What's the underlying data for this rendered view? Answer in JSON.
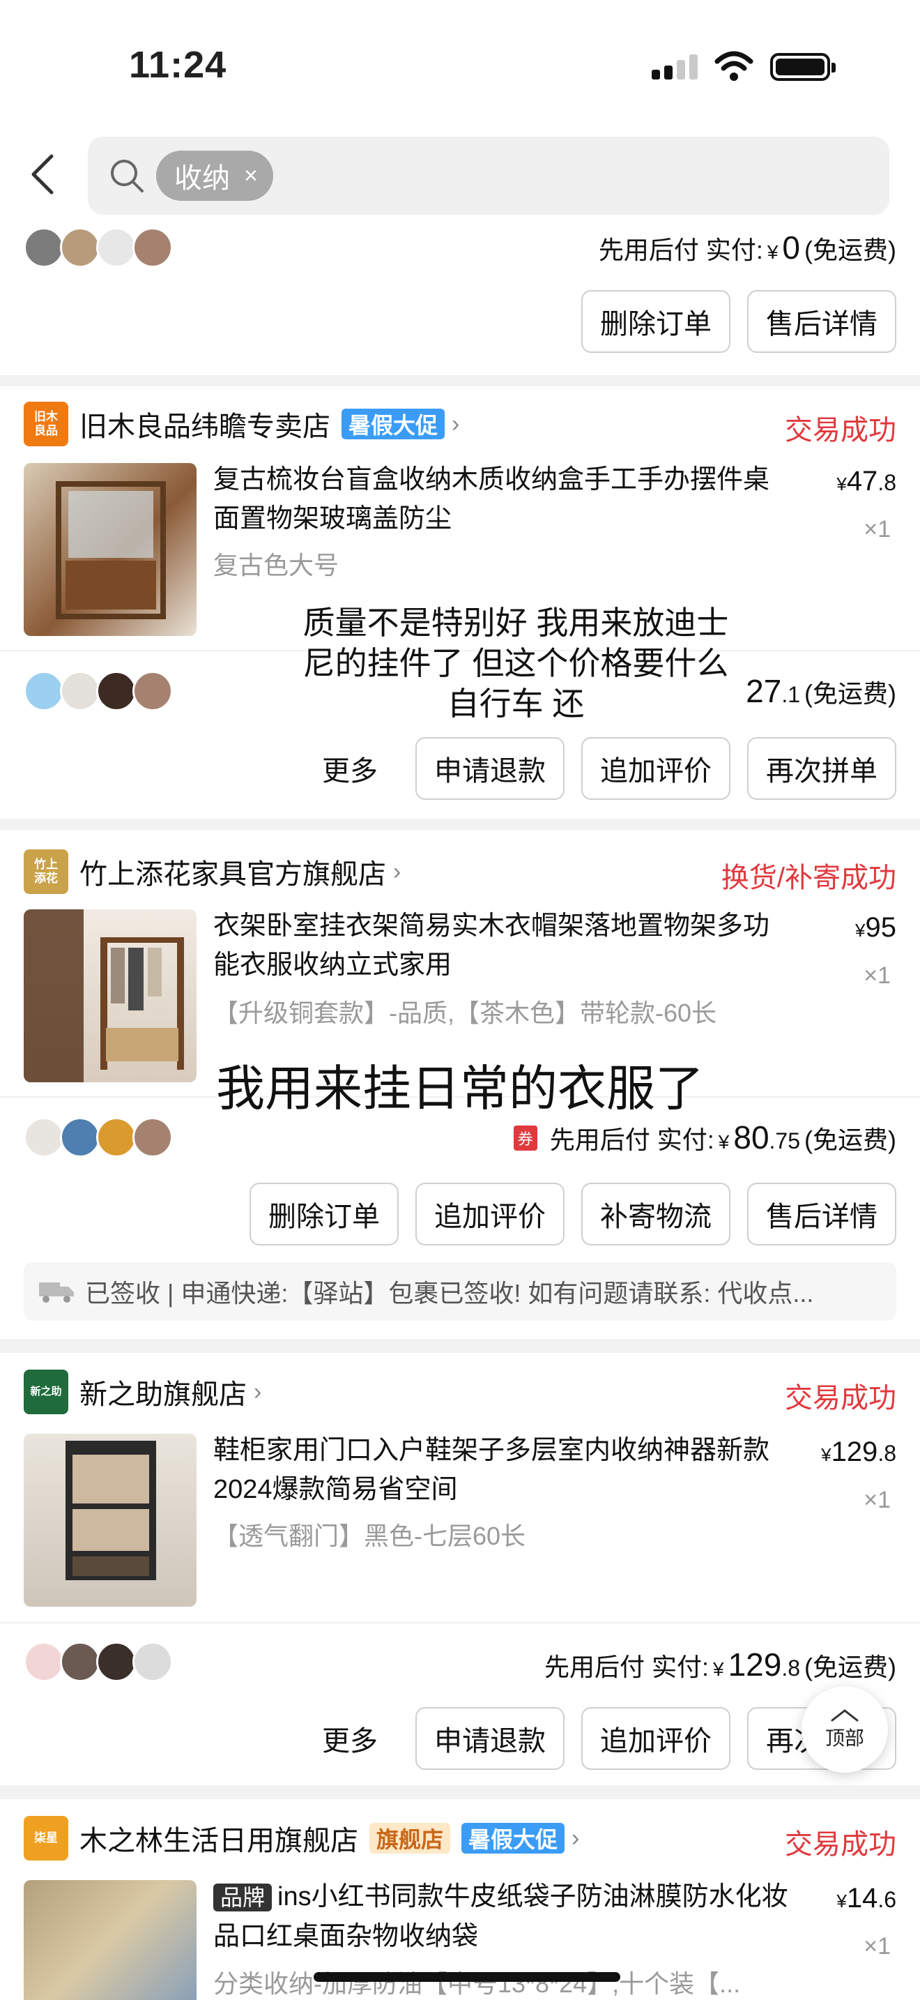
{
  "status_bar": {
    "time": "11:24"
  },
  "search": {
    "chip": "收纳",
    "chip_clear": "×"
  },
  "partial_order": {
    "payment_label": "先用后付 实付:",
    "currency": "¥",
    "amount": "0",
    "shipping": "(免运费)",
    "buttons": [
      "删除订单",
      "售后详情"
    ]
  },
  "orders": [
    {
      "shop_logo": "旧木\n良品",
      "shop_name": "旧木良品纬瞻专卖店",
      "tags": [
        "暑假大促"
      ],
      "status": "交易成功",
      "title": "复古梳妆台盲盒收纳木质收纳盒手工手办摆件桌面置物架玻璃盖防尘",
      "spec": "复古色大号",
      "price_int": "47",
      "price_dec": ".8",
      "qty": "×1",
      "amount_int": "27",
      "amount_dec": ".1",
      "shipping": "(免运费)",
      "more": "更多",
      "buttons": [
        "申请退款",
        "追加评价",
        "再次拼单"
      ]
    },
    {
      "shop_logo": "竹上\n添花",
      "shop_name": "竹上添花家具官方旗舰店",
      "status": "换货/补寄成功",
      "title": "衣架卧室挂衣架简易实木衣帽架落地置物架多功能衣服收纳立式家用",
      "spec": "【升级铜套款】-品质,【茶木色】带轮款-60长",
      "price_int": "95",
      "qty": "×1",
      "coupon": "券",
      "payment_label": "先用后付 实付:",
      "currency": "¥",
      "amount_int": "80",
      "amount_dec": ".75",
      "shipping": "(免运费)",
      "buttons": [
        "删除订单",
        "追加评价",
        "补寄物流",
        "售后详情"
      ],
      "logistics": "已签收 | 申通快递:【驿站】包裹已签收! 如有问题请联系: 代收点..."
    },
    {
      "shop_logo": "新之助",
      "shop_name": "新之助旗舰店",
      "status": "交易成功",
      "title": "鞋柜家用门口入户鞋架子多层室内收纳神器新款2024爆款简易省空间",
      "spec": "【透气翻门】黑色-七层60长",
      "price_int": "129",
      "price_dec": ".8",
      "qty": "×1",
      "payment_label": "先用后付 实付:",
      "currency": "¥",
      "amount_int": "129",
      "amount_dec": ".8",
      "shipping": "(免运费)",
      "more": "更多",
      "buttons": [
        "申请退款",
        "追加评价",
        "再次拼单"
      ]
    },
    {
      "shop_logo": "柒星",
      "shop_name": "木之林生活日用旗舰店",
      "tags": [
        "旗舰店",
        "暑假大促"
      ],
      "status": "交易成功",
      "brand_badge": "品牌",
      "title": "ins小红书同款牛皮纸袋子防油淋膜防水化妆品口红桌面杂物收纳袋",
      "spec": "分类收纳-加厚防油【中号13*8*24】,十个装【...",
      "price_int": "14",
      "price_dec": ".6",
      "qty": "×1"
    }
  ],
  "subtitles": {
    "first": "质量不是特别好 我用来放迪士尼的挂件了 但这个价格要什么自行车 还",
    "second": "我用来挂日常的衣服了"
  },
  "top_button": "顶部",
  "colors": {
    "accent_red": "#e0393e",
    "promo_blue": "#3b9cf5"
  }
}
